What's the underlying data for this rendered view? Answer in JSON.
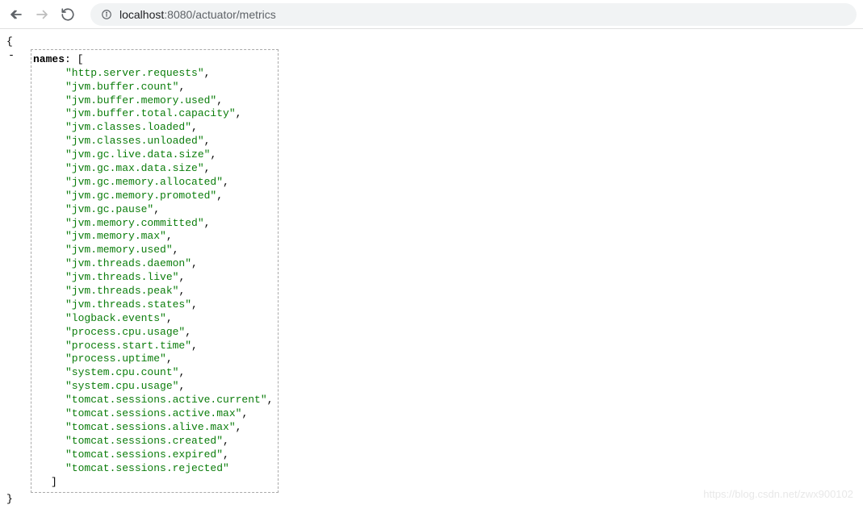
{
  "browser": {
    "url_host": "localhost",
    "url_port": ":8080",
    "url_path": "/actuator/metrics"
  },
  "json": {
    "open_brace": "{",
    "close_brace": "}",
    "toggle": "-",
    "key": "names",
    "colon": ":",
    "open_bracket": "[",
    "close_bracket": "]",
    "strings": [
      "http.server.requests",
      "jvm.buffer.count",
      "jvm.buffer.memory.used",
      "jvm.buffer.total.capacity",
      "jvm.classes.loaded",
      "jvm.classes.unloaded",
      "jvm.gc.live.data.size",
      "jvm.gc.max.data.size",
      "jvm.gc.memory.allocated",
      "jvm.gc.memory.promoted",
      "jvm.gc.pause",
      "jvm.memory.committed",
      "jvm.memory.max",
      "jvm.memory.used",
      "jvm.threads.daemon",
      "jvm.threads.live",
      "jvm.threads.peak",
      "jvm.threads.states",
      "logback.events",
      "process.cpu.usage",
      "process.start.time",
      "process.uptime",
      "system.cpu.count",
      "system.cpu.usage",
      "tomcat.sessions.active.current",
      "tomcat.sessions.active.max",
      "tomcat.sessions.alive.max",
      "tomcat.sessions.created",
      "tomcat.sessions.expired",
      "tomcat.sessions.rejected"
    ]
  },
  "watermark": "https://blog.csdn.net/zwx900102"
}
